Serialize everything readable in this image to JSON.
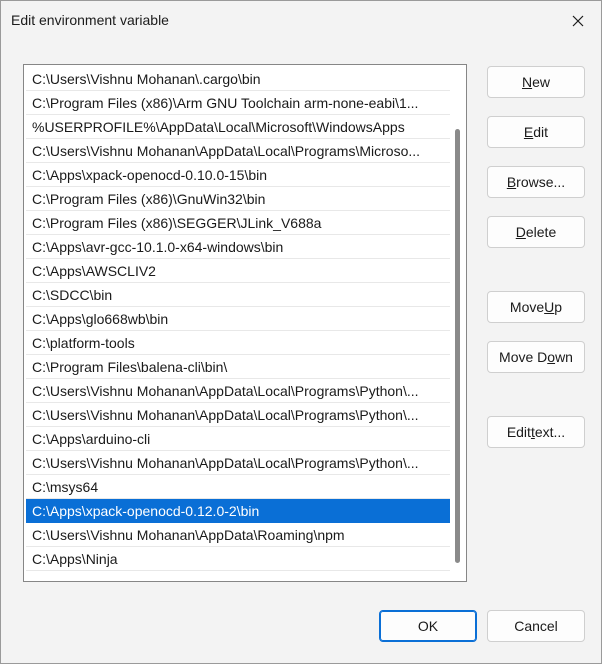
{
  "window": {
    "title": "Edit environment variable"
  },
  "paths": [
    "C:\\Users\\Vishnu Mohanan\\.cargo\\bin",
    "C:\\Program Files (x86)\\Arm GNU Toolchain arm-none-eabi\\1...",
    "%USERPROFILE%\\AppData\\Local\\Microsoft\\WindowsApps",
    "C:\\Users\\Vishnu Mohanan\\AppData\\Local\\Programs\\Microso...",
    "C:\\Apps\\xpack-openocd-0.10.0-15\\bin",
    "C:\\Program Files (x86)\\GnuWin32\\bin",
    "C:\\Program Files (x86)\\SEGGER\\JLink_V688a",
    "C:\\Apps\\avr-gcc-10.1.0-x64-windows\\bin",
    "C:\\Apps\\AWSCLIV2",
    "C:\\SDCC\\bin",
    "C:\\Apps\\glo668wb\\bin",
    "C:\\platform-tools",
    "C:\\Program Files\\balena-cli\\bin\\",
    "C:\\Users\\Vishnu Mohanan\\AppData\\Local\\Programs\\Python\\...",
    "C:\\Users\\Vishnu Mohanan\\AppData\\Local\\Programs\\Python\\...",
    "C:\\Apps\\arduino-cli",
    "C:\\Users\\Vishnu Mohanan\\AppData\\Local\\Programs\\Python\\...",
    "C:\\msys64",
    "C:\\Apps\\xpack-openocd-0.12.0-2\\bin",
    "C:\\Users\\Vishnu Mohanan\\AppData\\Roaming\\npm",
    "C:\\Apps\\Ninja"
  ],
  "selected_index": 18,
  "buttons": {
    "new": {
      "pre": "",
      "key": "N",
      "post": "ew"
    },
    "edit": {
      "pre": "",
      "key": "E",
      "post": "dit"
    },
    "browse": {
      "pre": "",
      "key": "B",
      "post": "rowse..."
    },
    "delete": {
      "pre": "",
      "key": "D",
      "post": "elete"
    },
    "move_up": {
      "pre": "Move ",
      "key": "U",
      "post": "p"
    },
    "move_down": {
      "pre": "Move D",
      "key": "o",
      "post": "wn"
    },
    "edit_text": {
      "pre": "Edit ",
      "key": "t",
      "post": "ext..."
    }
  },
  "footer": {
    "ok_label": "OK",
    "cancel_label": "Cancel"
  },
  "icons": {
    "close": "close-icon"
  }
}
